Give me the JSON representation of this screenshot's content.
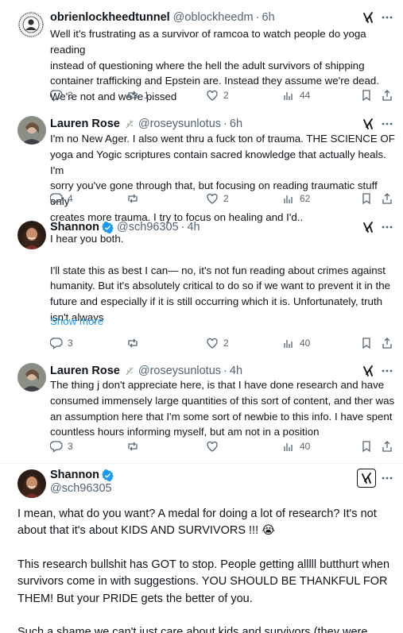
{
  "tweets": [
    {
      "name": "obrienlockheedtunnel",
      "handle": "@oblockheedm",
      "time": "6h",
      "text": "Well it's frustrating as a survivor of ramcoa to watch people do yoga reading\ninstead of questioning where the hell the adult survivors of shipping\ncontainer trafficking and Epstein are. Instead they assume we're dead.\nWe're not and we're pissed",
      "replies": "3",
      "reposts": "1",
      "likes": "2",
      "views": "44"
    },
    {
      "name": "Lauren Rose",
      "handle": "@roseysunlotus",
      "time": "6h",
      "text": "I'm no New Ager. I also went thru a fuck ton of trauma. THE SCIENCE OF\nyoga and Yogic scriptures contain sacred knowledge that actually heals. I'm\nsorry you've gone through that, but focusing on reading traumatic stuff only\ncreates more trauma. I try to focus on healing and I'd..",
      "replies": "4",
      "reposts": "",
      "likes": "2",
      "views": "62"
    },
    {
      "name": "Shannon",
      "handle": "@sch96305",
      "time": "4h",
      "text": "I hear you both.\n\nI'll state this as best I can— no, it's not fun reading about crimes against\nhumanity. But it's absolutely critical to do so if we want to prevent it in the\nfuture and especially if it is still occurring which it is. Unfortunately, truth\nisn't always",
      "show_more": "Show more",
      "replies": "3",
      "reposts": "",
      "likes": "2",
      "views": "40"
    },
    {
      "name": "Lauren Rose",
      "handle": "@roseysunlotus",
      "time": "4h",
      "text": "The thing j don't appreciate here, is that I have done research and have\nconsumed immensely large quantities of this sort of content, and ther was\nan assumption here that I'm some sort of newbie to this info. I have spent\ncountless hours informing myself, but am not in a position",
      "replies": "3",
      "reposts": "",
      "likes": "",
      "views": "40"
    }
  ],
  "main_tweet": {
    "name": "Shannon",
    "handle": "@sch96305",
    "para1": "I mean, what do you want? A medal for doing a lot of research? It's not about that it's about KIDS AND SURVIVORS !!! 😭",
    "para2": "This research bullshit has GOT to stop. People getting alllll butthurt when survivors come in with suggestions. YOU SHOULD BE THANKFUL FOR THEM! But your PRIDE gets the better of you.",
    "para3": "Such a shame we can't just care about kids and survivors (they were"
  },
  "colors": {
    "text": "#0f1419",
    "muted": "#536471",
    "link": "#1d9bf0",
    "verified": "#1d9bf0"
  }
}
